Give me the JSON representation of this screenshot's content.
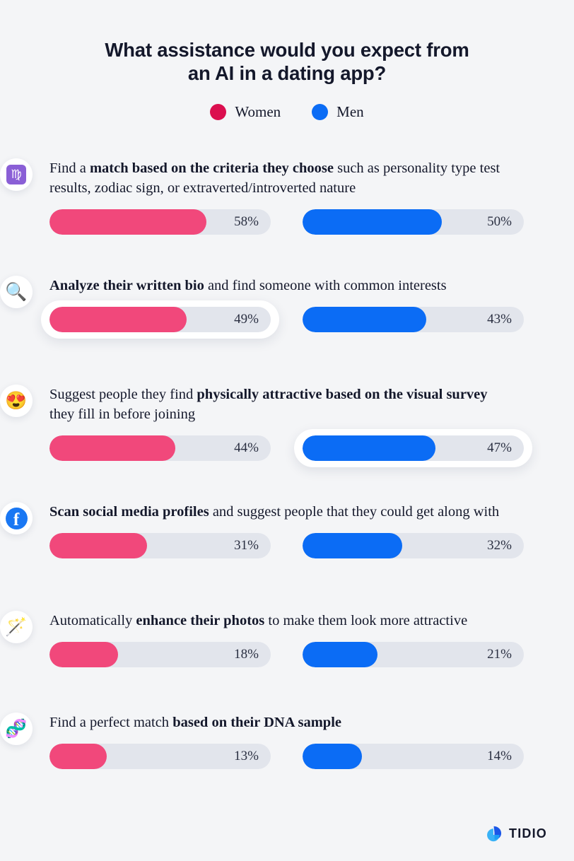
{
  "title": {
    "line1": "What assistance would you expect from",
    "line2": "an AI in a dating app?"
  },
  "legend": {
    "items": [
      {
        "label": "Women",
        "color": "#db0f4f"
      },
      {
        "label": "Men",
        "color": "#0b6cf5"
      }
    ]
  },
  "colors": {
    "background": "#f4f5f7",
    "women_bar": "#f1487b",
    "men_bar": "#0b6cf5",
    "track": "#e2e5ec",
    "text": "#14182b"
  },
  "chart_data": {
    "type": "bar",
    "title": "What assistance would you expect from an AI in a dating app?",
    "xlabel": "",
    "ylabel": "",
    "xlim": [
      0,
      100
    ],
    "grid": false,
    "legend_position": "top-center",
    "value_suffix": "%",
    "categories": [
      "Find a match based on the criteria they choose such as personality type test results, zodiac sign, or extraverted/introverted nature",
      "Analyze their written bio and find someone with common interests",
      "Suggest people they find physically attractive based on the visual survey they fill in before joining",
      "Scan social media profiles and suggest people that they could get along with",
      "Automatically enhance their photos to make them look more attractive",
      "Find a perfect match based on their DNA sample"
    ],
    "series": [
      {
        "name": "Women",
        "color": "#f1487b",
        "values": [
          58,
          49,
          44,
          31,
          18,
          13
        ]
      },
      {
        "name": "Men",
        "color": "#0b6cf5",
        "values": [
          50,
          43,
          47,
          32,
          21,
          14
        ]
      }
    ]
  },
  "rows": [
    {
      "icon": "virgo-zodiac-icon",
      "icon_glyph": "♍",
      "text_parts": [
        {
          "text": "Find a ",
          "bold": false
        },
        {
          "text": "match based on the criteria they choose",
          "bold": true
        },
        {
          "text": " such as personality type test results, zodiac sign, or extraverted/introverted nature",
          "bold": false
        }
      ],
      "women": {
        "value": 58,
        "label": "58%",
        "highlight": false
      },
      "men": {
        "value": 50,
        "label": "50%",
        "highlight": false
      }
    },
    {
      "icon": "magnifying-glass-icon",
      "icon_glyph": "🔍",
      "text_parts": [
        {
          "text": "Analyze their written bio",
          "bold": true
        },
        {
          "text": " and find someone with common interests",
          "bold": false
        }
      ],
      "women": {
        "value": 49,
        "label": "49%",
        "highlight": true
      },
      "men": {
        "value": 43,
        "label": "43%",
        "highlight": false
      }
    },
    {
      "icon": "heart-eyes-face-icon",
      "icon_glyph": "😍",
      "text_parts": [
        {
          "text": "Suggest people they find ",
          "bold": false
        },
        {
          "text": "physically attractive based on the visual survey",
          "bold": true
        },
        {
          "text": " they fill in before joining",
          "bold": false
        }
      ],
      "women": {
        "value": 44,
        "label": "44%",
        "highlight": false
      },
      "men": {
        "value": 47,
        "label": "47%",
        "highlight": true
      }
    },
    {
      "icon": "facebook-icon",
      "icon_glyph": "f",
      "text_parts": [
        {
          "text": "Scan social media profiles",
          "bold": true
        },
        {
          "text": " and suggest people that they could get along with",
          "bold": false
        }
      ],
      "women": {
        "value": 31,
        "label": "31%",
        "highlight": false
      },
      "men": {
        "value": 32,
        "label": "32%",
        "highlight": false
      }
    },
    {
      "icon": "magic-wand-icon",
      "icon_glyph": "🪄",
      "text_parts": [
        {
          "text": "Automatically ",
          "bold": false
        },
        {
          "text": "enhance their photos",
          "bold": true
        },
        {
          "text": " to make them look more attractive",
          "bold": false
        }
      ],
      "women": {
        "value": 18,
        "label": "18%",
        "highlight": false
      },
      "men": {
        "value": 21,
        "label": "21%",
        "highlight": false
      }
    },
    {
      "icon": "dna-icon",
      "icon_glyph": "🧬",
      "text_parts": [
        {
          "text": "Find a perfect match ",
          "bold": false
        },
        {
          "text": "based on their DNA sample",
          "bold": true
        }
      ],
      "women": {
        "value": 13,
        "label": "13%",
        "highlight": false
      },
      "men": {
        "value": 14,
        "label": "14%",
        "highlight": false
      }
    }
  ],
  "footer": {
    "brand": "TIDIO"
  }
}
